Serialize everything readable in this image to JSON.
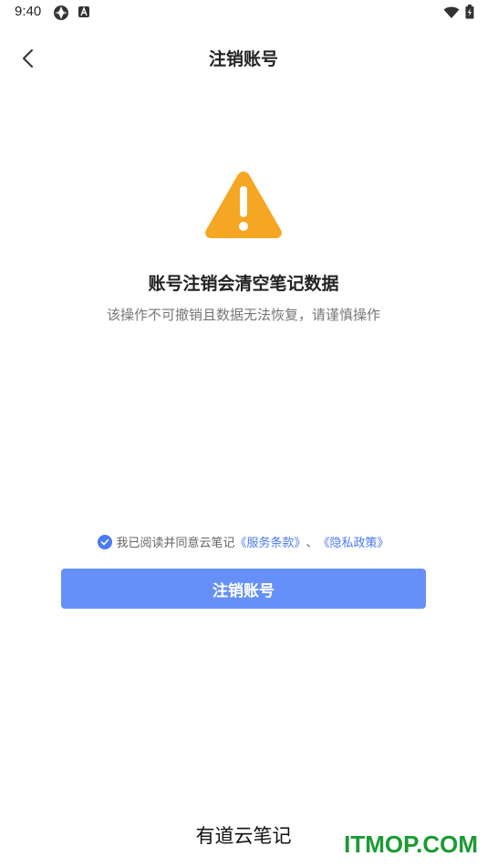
{
  "status_bar": {
    "time": "9:40"
  },
  "header": {
    "title": "注销账号"
  },
  "warning": {
    "heading": "账号注销会清空笔记数据",
    "subtext": "该操作不可撤销且数据无法恢复，请谨慎操作"
  },
  "agreement": {
    "prefix": "我已阅读并同意云笔记",
    "terms_link": "《服务条款》",
    "separator": "、",
    "privacy_link": "《隐私政策》",
    "checked": true
  },
  "actions": {
    "cancel_account_label": "注销账号"
  },
  "footer": {
    "brand": "有道云笔记"
  },
  "watermark": {
    "text": "ITMOP.COM"
  },
  "colors": {
    "accent": "#4a7af5",
    "button": "#6690f7",
    "warning": "#f5a623",
    "watermark": "#1a9b33"
  }
}
